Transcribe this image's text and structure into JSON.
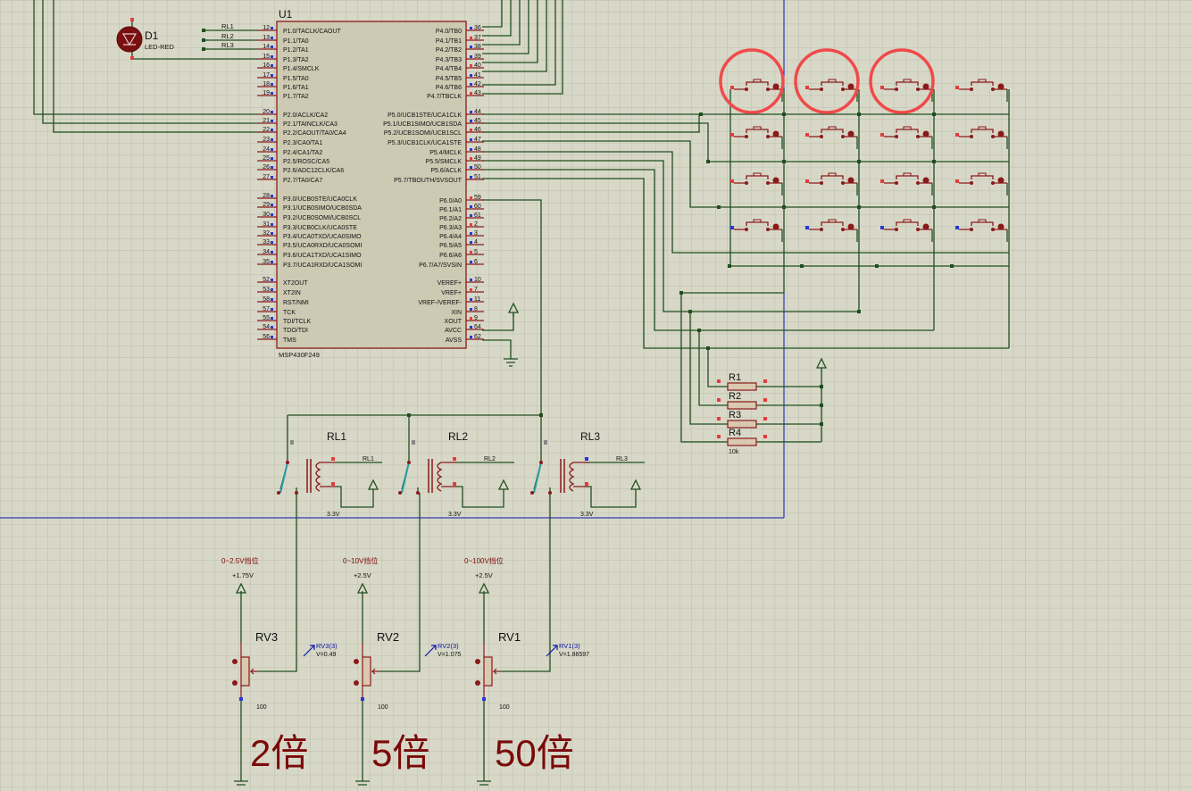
{
  "colors": {
    "background": "#d8d8c8",
    "grid": "#bdbdab",
    "wire": "#1f4f1f",
    "component_outline": "#8a1a1a",
    "chip_fill": "#cdc9b2",
    "pin_blue": "#2a36d8",
    "pin_red": "#e63b3b",
    "highlight_circle": "#f04a4a",
    "frame_blue": "#0a14a8",
    "annotation_red": "#7a0a0a",
    "probe_blue": "#0a14a8"
  },
  "mcu": {
    "ref": "U1",
    "part": "MSP430F249",
    "left_pins": [
      {
        "num": "12",
        "name": "P1.0/TACLK/CAOUT"
      },
      {
        "num": "13",
        "name": "P1.1/TA0"
      },
      {
        "num": "14",
        "name": "P1.2/TA1"
      },
      {
        "num": "15",
        "name": "P1.3/TA2"
      },
      {
        "num": "16",
        "name": "P1.4/SMCLK"
      },
      {
        "num": "17",
        "name": "P1.5/TA0"
      },
      {
        "num": "18",
        "name": "P1.6/TA1"
      },
      {
        "num": "19",
        "name": "P1.7/TA2"
      },
      {
        "num": "20",
        "name": "P2.0/ACLK/CA2"
      },
      {
        "num": "21",
        "name": "P2.1/TAINCLK/CA3"
      },
      {
        "num": "22",
        "name": "P2.2/CAOUT/TA0/CA4"
      },
      {
        "num": "23",
        "name": "P2.3/CA0/TA1"
      },
      {
        "num": "24",
        "name": "P2.4/CA1/TA2"
      },
      {
        "num": "25",
        "name": "P2.5/ROSC/CA5"
      },
      {
        "num": "26",
        "name": "P2.6/ADC12CLK/CA6"
      },
      {
        "num": "27",
        "name": "P2.7/TA0/CA7"
      },
      {
        "num": "28",
        "name": "P3.0/UCB0STE/UCA0CLK"
      },
      {
        "num": "29",
        "name": "P3.1/UCB0SIMO/UCB0SDA"
      },
      {
        "num": "30",
        "name": "P3.2/UCB0SOMI/UCB0SCL"
      },
      {
        "num": "31",
        "name": "P3.3/UCB0CLK/UCA0STE"
      },
      {
        "num": "32",
        "name": "P3.4/UCA0TXD/UCA0SIMO"
      },
      {
        "num": "33",
        "name": "P3.5/UCA0RXD/UCA0SOMI"
      },
      {
        "num": "34",
        "name": "P3.6/UCA1TXD/UCA1SIMO"
      },
      {
        "num": "35",
        "name": "P3.7/UCA1RXD/UCA1SOMI"
      },
      {
        "num": "52",
        "name": "XT2OUT"
      },
      {
        "num": "53",
        "name": "XT2IN"
      },
      {
        "num": "58",
        "name": "RST/NMI"
      },
      {
        "num": "57",
        "name": "TCK"
      },
      {
        "num": "55",
        "name": "TDI/TCLK"
      },
      {
        "num": "54",
        "name": "TDO/TDI"
      },
      {
        "num": "56",
        "name": "TMS"
      }
    ],
    "right_pins": [
      {
        "num": "36",
        "name": "P4.0/TB0"
      },
      {
        "num": "37",
        "name": "P4.1/TB1"
      },
      {
        "num": "38",
        "name": "P4.2/TB2"
      },
      {
        "num": "39",
        "name": "P4.3/TB3"
      },
      {
        "num": "40",
        "name": "P4.4/TB4"
      },
      {
        "num": "41",
        "name": "P4.5/TB5"
      },
      {
        "num": "42",
        "name": "P4.6/TB6"
      },
      {
        "num": "43",
        "name": "P4.7/TBCLK"
      },
      {
        "num": "44",
        "name": "P5.0/UCB1STE/UCA1CLK"
      },
      {
        "num": "45",
        "name": "P5.1/UCB1SIMO/UCB1SDA"
      },
      {
        "num": "46",
        "name": "P5.2/UCB1SOMI/UCB1SCL"
      },
      {
        "num": "47",
        "name": "P5.3/UCB1CLK/UCA1STE"
      },
      {
        "num": "48",
        "name": "P5.4/MCLK"
      },
      {
        "num": "49",
        "name": "P5.5/SMCLK"
      },
      {
        "num": "50",
        "name": "P5.6/ACLK"
      },
      {
        "num": "51",
        "name": "P5.7/TBOUTH/SVSOUT"
      },
      {
        "num": "59",
        "name": "P6.0/A0"
      },
      {
        "num": "60",
        "name": "P6.1/A1"
      },
      {
        "num": "61",
        "name": "P6.2/A2"
      },
      {
        "num": "2",
        "name": "P6.3/A3"
      },
      {
        "num": "3",
        "name": "P6.4/A4"
      },
      {
        "num": "4",
        "name": "P6.5/A5"
      },
      {
        "num": "5",
        "name": "P6.6/A6"
      },
      {
        "num": "6",
        "name": "P6.7/A7/SVSIN"
      },
      {
        "num": "10",
        "name": "VEREF+"
      },
      {
        "num": "7",
        "name": "VREF+"
      },
      {
        "num": "11",
        "name": "VREF-/VEREF-"
      },
      {
        "num": "8",
        "name": "XIN"
      },
      {
        "num": "9",
        "name": "XOUT"
      },
      {
        "num": "64",
        "name": "AVCC"
      },
      {
        "num": "62",
        "name": "AVSS"
      }
    ]
  },
  "net_labels": [
    "RL1",
    "RL2",
    "RL3"
  ],
  "led": {
    "ref": "D1",
    "part": "LED-RED"
  },
  "resistors": [
    {
      "ref": "R1"
    },
    {
      "ref": "R2"
    },
    {
      "ref": "R3"
    },
    {
      "ref": "R4",
      "value": "10k"
    }
  ],
  "relays": [
    {
      "ref": "RL1",
      "net": "RL1",
      "supply": "3.3V"
    },
    {
      "ref": "RL2",
      "net": "RL2",
      "supply": "3.3V"
    },
    {
      "ref": "RL3",
      "net": "RL3",
      "supply": "3.3V"
    }
  ],
  "pots": [
    {
      "ref": "RV3",
      "range_label": "0~2.5V挡位",
      "voltage": "+1.75V",
      "probe_name": "RV3(3)",
      "probe_value": "V=0.49",
      "value": "100",
      "gain": "2倍"
    },
    {
      "ref": "RV2",
      "range_label": "0~10V挡位",
      "voltage": "+2.5V",
      "probe_name": "RV2(3)",
      "probe_value": "V=1.075",
      "value": "100",
      "gain": "5倍"
    },
    {
      "ref": "RV1",
      "range_label": "0~100V挡位",
      "voltage": "+2.5V",
      "probe_name": "RV1(3)",
      "probe_value": "V=1.86597",
      "value": "100",
      "gain": "50倍"
    }
  ],
  "keypad": {
    "rows": 4,
    "cols": 4,
    "highlighted": [
      "key-1-1",
      "key-1-2",
      "key-1-3"
    ]
  }
}
